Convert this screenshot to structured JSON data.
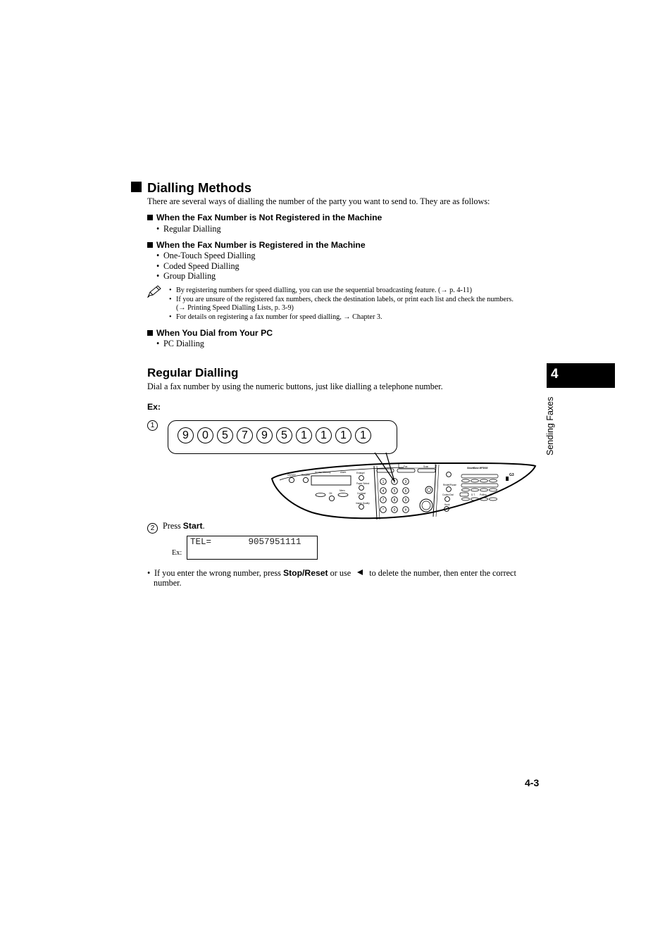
{
  "section": {
    "title": "Dialling Methods",
    "intro": "There are several ways of dialling the number of the party you want to send to. They are as follows:",
    "groups": [
      {
        "heading": "When the Fax Number is Not Registered in the Machine",
        "items": [
          "Regular Dialling"
        ]
      },
      {
        "heading": "When the Fax Number is Registered in the Machine",
        "items": [
          "One-Touch Speed Dialling",
          "Coded Speed Dialling",
          "Group Dialling"
        ]
      },
      {
        "heading": "When You Dial from Your PC",
        "items": [
          "PC Dialling"
        ]
      }
    ],
    "note": {
      "icon": "pencil-note-icon",
      "items": [
        "By registering numbers for speed dialling, you can use the sequential broadcasting feature. (→ p. 4-11)",
        "If you are unsure of the registered fax numbers, check the destination labels, or print each list and check the numbers.",
        "(→ Printing Speed Dialling Lists, p. 3-9)",
        "For details on registering a fax number for speed dialling, → Chapter 3."
      ]
    }
  },
  "regular": {
    "title": "Regular Dialling",
    "intro": "Dial a fax number by using the numeric buttons, just like dialling a telephone number.",
    "ex_label": "Ex:",
    "step1_num": "1",
    "digits": [
      "9",
      "0",
      "5",
      "7",
      "9",
      "5",
      "1",
      "1",
      "1",
      "1"
    ],
    "step2_num": "2",
    "step2_prefix": "Press ",
    "step2_button": "Start",
    "step2_suffix": ".",
    "lcd_ex_label": "Ex:",
    "lcd_text": "TEL=       9057951111",
    "tip_prefix": "If you enter the wrong number, press ",
    "tip_button": "Stop/Reset",
    "tip_middle": " or use ",
    "tip_icon": "left-arrow-icon",
    "tip_suffix": " to delete the number, then enter the correct",
    "tip_line2": "number."
  },
  "panel": {
    "labels": {
      "on_off": "ON/OFF",
      "resume": "Resume",
      "in_use_memory": "In Use/ Memory",
      "alarm": "Alarm",
      "enlarge_reduce": "Enlarge/ Reduce",
      "paper_select": "Paper Select",
      "contrast": "Contrast",
      "image_quality": "Image Quality",
      "ok": "OK",
      "menu": "Menu",
      "fax": "Fax",
      "scan": "Scan",
      "redial_pause": "Redial/Pause",
      "coded_dial": "Coded Dial",
      "hook": "Hook",
      "dt": "D.T.",
      "polling": "Polling",
      "r": "R",
      "brand": "SmartBase MP3000",
      "g3": "G3"
    },
    "keypad": [
      "1",
      "2",
      "3",
      "4",
      "5",
      "6",
      "7",
      "8",
      "9",
      "*",
      "0",
      "#"
    ]
  },
  "sidebar": {
    "chapter_number": "4",
    "chapter_title": "Sending Faxes"
  },
  "footer": {
    "page_number": "4-3"
  }
}
